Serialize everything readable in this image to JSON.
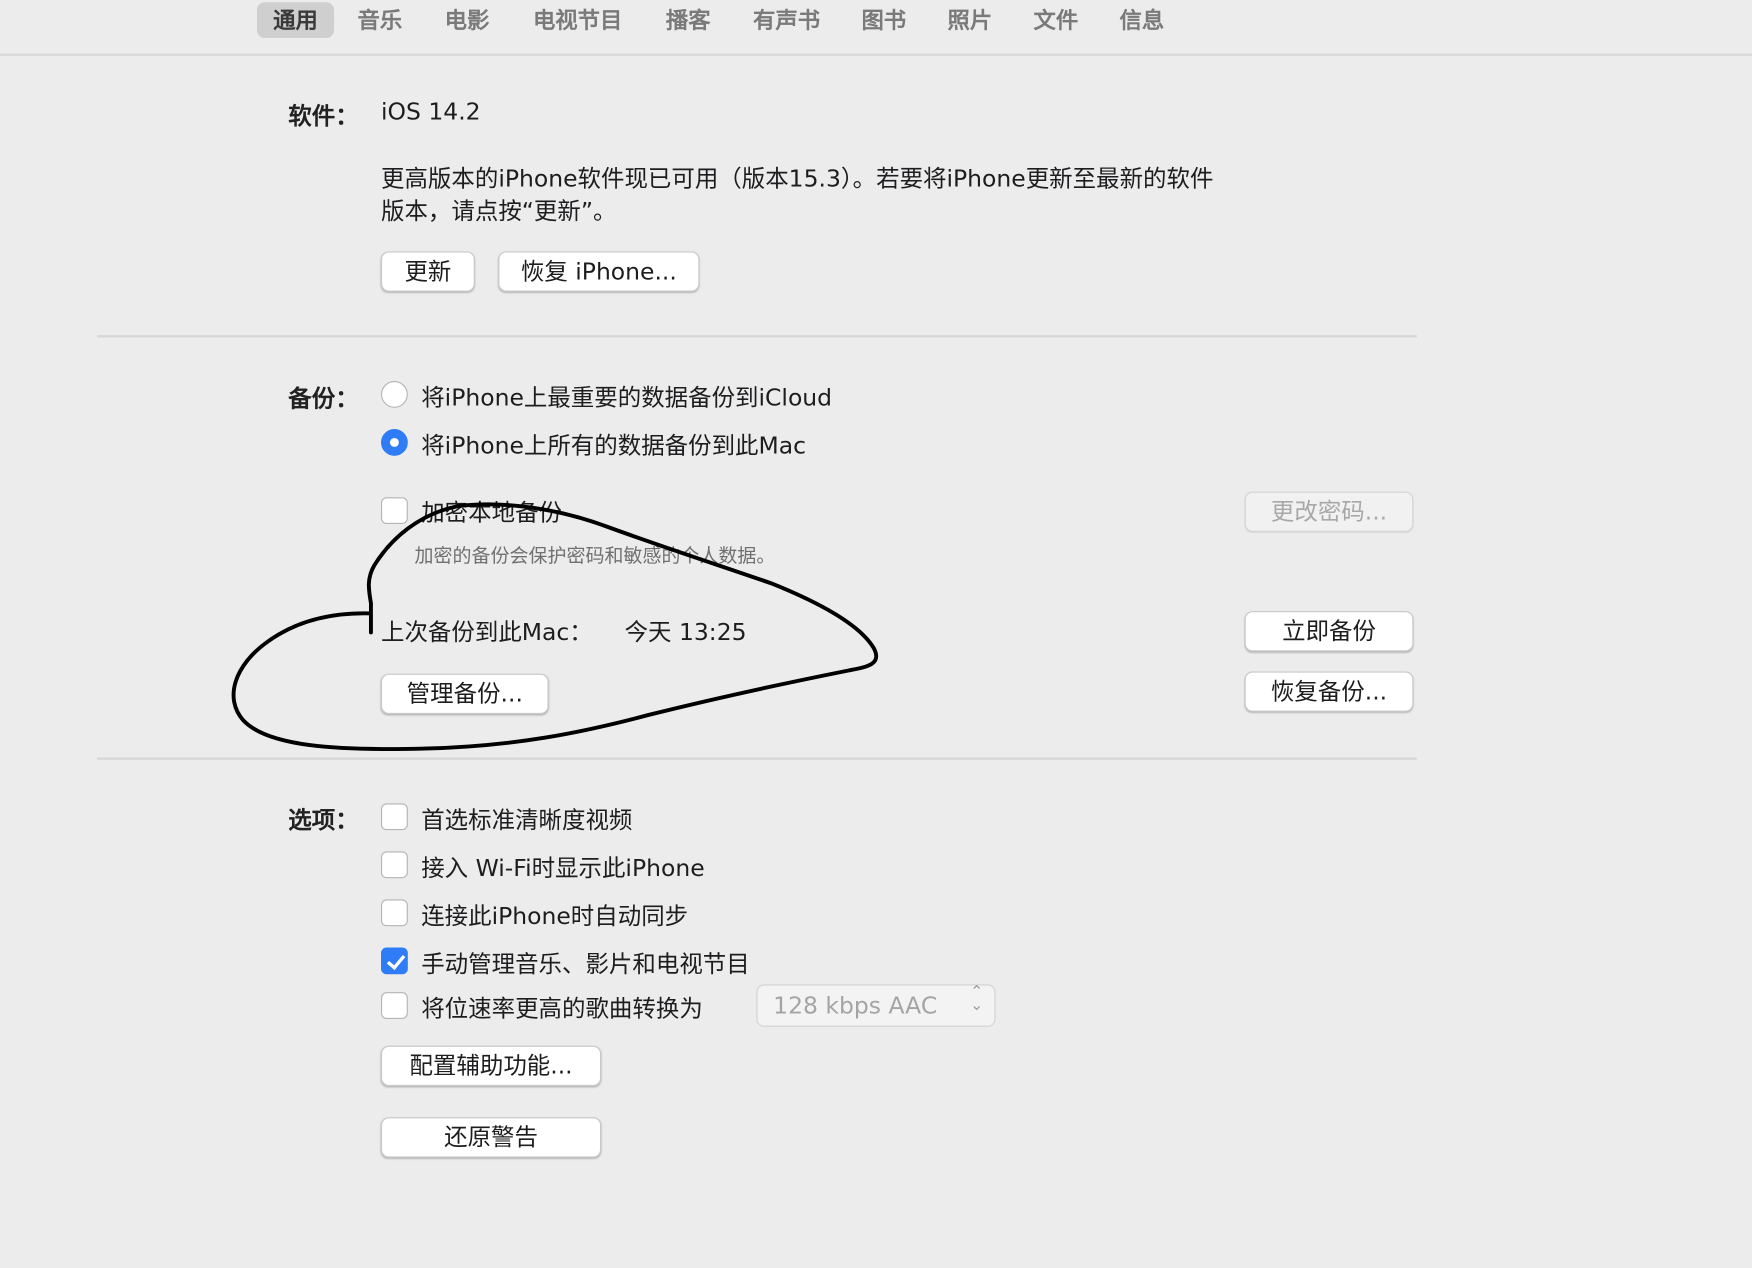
{
  "tabs": [
    "通用",
    "音乐",
    "电影",
    "电视节目",
    "播客",
    "有声书",
    "图书",
    "照片",
    "文件",
    "信息"
  ],
  "active_tab": "通用",
  "software": {
    "label": "软件：",
    "version": "iOS 14.2",
    "message_line1": "更高版本的iPhone软件现已可用（版本15.3）。若要将iPhone更新至最新的软件",
    "message_line2": "版本，请点按“更新”。",
    "update_button": "更新",
    "restore_button": "恢复 iPhone..."
  },
  "backup": {
    "label": "备份：",
    "option_icloud": "将iPhone上最重要的数据备份到iCloud",
    "option_mac": "将iPhone上所有的数据备份到此Mac",
    "selected": "mac",
    "encrypt_label": "加密本地备份",
    "encrypt_checked": false,
    "encrypt_note": "加密的备份会保护密码和敏感的个人数据。",
    "change_password_button": "更改密码...",
    "last_backup_label": "上次备份到此Mac：",
    "last_backup_time": "今天 13:25",
    "backup_now_button": "立即备份",
    "manage_backups_button": "管理备份...",
    "restore_backup_button": "恢复备份..."
  },
  "options": {
    "label": "选项：",
    "items": [
      {
        "label": "首选标准清晰度视频",
        "checked": false
      },
      {
        "label": "接入 Wi-Fi时显示此iPhone",
        "checked": false
      },
      {
        "label": "连接此iPhone时自动同步",
        "checked": false
      },
      {
        "label": "手动管理音乐、影片和电视节目",
        "checked": true
      },
      {
        "label": "将位速率更高的歌曲转换为",
        "checked": false
      }
    ],
    "bitrate_select": "128 kbps AAC",
    "accessibility_button": "配置辅助功能...",
    "reset_warnings_button": "还原警告"
  },
  "colors": {
    "accent": "#2f7cf6",
    "background": "#ececec",
    "annotation_stroke": "#000000"
  }
}
